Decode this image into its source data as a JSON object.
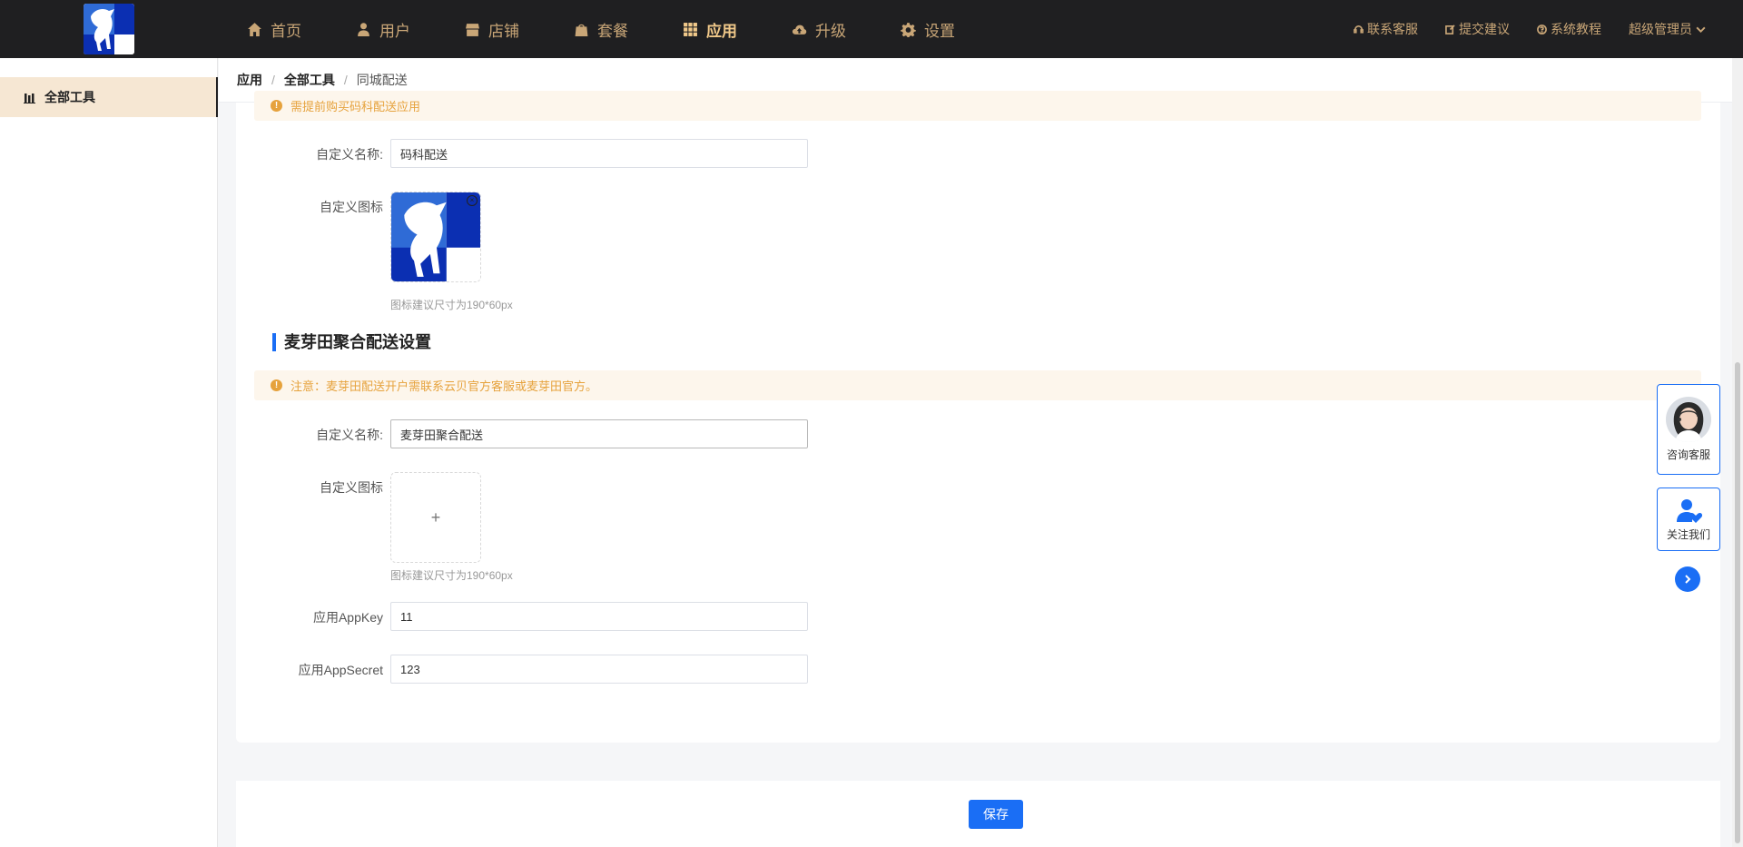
{
  "nav": {
    "items": [
      {
        "label": "首页",
        "icon": "home-icon",
        "active": false
      },
      {
        "label": "用户",
        "icon": "user-icon",
        "active": false
      },
      {
        "label": "店铺",
        "icon": "store-icon",
        "active": false
      },
      {
        "label": "套餐",
        "icon": "package-icon",
        "active": false
      },
      {
        "label": "应用",
        "icon": "grid-icon",
        "active": true
      },
      {
        "label": "升级",
        "icon": "cloud-upload-icon",
        "active": false
      },
      {
        "label": "设置",
        "icon": "gear-icon",
        "active": false
      }
    ],
    "right": {
      "contact": "联系客服",
      "feedback": "提交建议",
      "tutorial": "系统教程",
      "admin": "超级管理员"
    }
  },
  "sidebar": {
    "items": [
      {
        "label": "全部工具",
        "active": true
      }
    ]
  },
  "breadcrumb": [
    "应用",
    "全部工具",
    "同城配送"
  ],
  "section1": {
    "notice": "需提前购买码科配送应用",
    "name_label": "自定义名称:",
    "name_value": "码科配送",
    "icon_label": "自定义图标",
    "icon_hint": "图标建议尺寸为190*60px"
  },
  "section2": {
    "title": "麦芽田聚合配送设置",
    "notice": "注意：麦芽田配送开户需联系云贝官方客服或麦芽田官方。",
    "name_label": "自定义名称:",
    "name_value": "麦芽田聚合配送",
    "icon_label": "自定义图标",
    "icon_plus": "+",
    "icon_hint": "图标建议尺寸为190*60px",
    "appkey_label": "应用AppKey",
    "appkey_value": "11",
    "appsecret_label": "应用AppSecret",
    "appsecret_value": "123"
  },
  "footer": {
    "save_label": "保存"
  },
  "float": {
    "consult_label": "咨询客服",
    "follow_label": "关注我们"
  },
  "colors": {
    "accent": "#1a6ef5",
    "nav_bg": "#1f1f21",
    "nav_text": "#c9a677",
    "warning": "#e6a23c"
  }
}
